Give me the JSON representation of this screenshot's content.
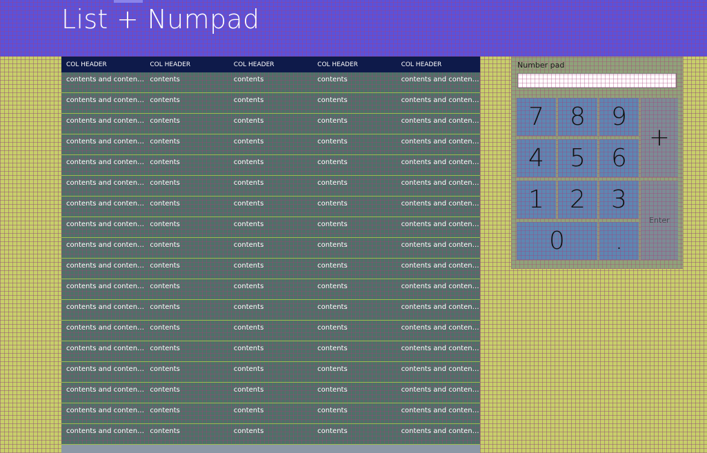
{
  "title": "List + Numpad",
  "list": {
    "headers": [
      "COL HEADER",
      "COL HEADER",
      "COL HEADER",
      "COL HEADER",
      "COL HEADER"
    ],
    "rows": [
      [
        "contents and content...",
        "contents",
        "contents",
        "contents",
        "contents and content..."
      ],
      [
        "contents and content...",
        "contents",
        "contents",
        "contents",
        "contents and content..."
      ],
      [
        "contents and content...",
        "contents",
        "contents",
        "contents",
        "contents and content..."
      ],
      [
        "contents and content...",
        "contents",
        "contents",
        "contents",
        "contents and content..."
      ],
      [
        "contents and content...",
        "contents",
        "contents",
        "contents",
        "contents and content..."
      ],
      [
        "contents and content...",
        "contents",
        "contents",
        "contents",
        "contents and content..."
      ],
      [
        "contents and content...",
        "contents",
        "contents",
        "contents",
        "contents and content..."
      ],
      [
        "contents and content...",
        "contents",
        "contents",
        "contents",
        "contents and content..."
      ],
      [
        "contents and content...",
        "contents",
        "contents",
        "contents",
        "contents and content..."
      ],
      [
        "contents and content...",
        "contents",
        "contents",
        "contents",
        "contents and content..."
      ],
      [
        "contents and content...",
        "contents",
        "contents",
        "contents",
        "contents and content..."
      ],
      [
        "contents and content...",
        "contents",
        "contents",
        "contents",
        "contents and content..."
      ],
      [
        "contents and content...",
        "contents",
        "contents",
        "contents",
        "contents and content..."
      ],
      [
        "contents and content...",
        "contents",
        "contents",
        "contents",
        "contents and content..."
      ],
      [
        "contents and content...",
        "contents",
        "contents",
        "contents",
        "contents and content..."
      ],
      [
        "contents and content...",
        "contents",
        "contents",
        "contents",
        "contents and content..."
      ],
      [
        "contents and content...",
        "contents",
        "contents",
        "contents",
        "contents and content..."
      ],
      [
        "contents and content...",
        "contents",
        "contents",
        "contents",
        "contents and content..."
      ]
    ]
  },
  "numpad": {
    "label": "Number pad",
    "input_value": "",
    "keys": {
      "k7": "7",
      "k8": "8",
      "k9": "9",
      "k4": "4",
      "k5": "5",
      "k6": "6",
      "k1": "1",
      "k2": "2",
      "k3": "3",
      "k0": "0",
      "dot": ".",
      "plus": "+",
      "enter": "Enter"
    }
  },
  "colors": {
    "header_bg": "#5b52d9",
    "list_bg": "#4f7068",
    "list_header_bg": "#0e1a4a",
    "numpad_key": "#5e86b1",
    "page_bg": "#c8cf6a"
  }
}
